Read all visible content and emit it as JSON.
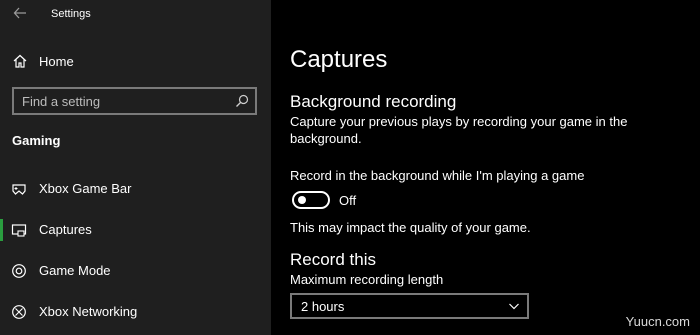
{
  "window": {
    "title": "Settings"
  },
  "sidebar": {
    "home_label": "Home",
    "search_placeholder": "Find a setting",
    "section_heading": "Gaming",
    "items": [
      {
        "label": "Xbox Game Bar",
        "icon": "game-bar-icon"
      },
      {
        "label": "Captures",
        "icon": "captures-icon",
        "selected": true
      },
      {
        "label": "Game Mode",
        "icon": "game-mode-icon"
      },
      {
        "label": "Xbox Networking",
        "icon": "xbox-icon"
      }
    ],
    "accent_color": "#2a9d3f"
  },
  "main": {
    "title": "Captures",
    "background_recording": {
      "heading": "Background recording",
      "description": "Capture your previous plays by recording your game in the background.",
      "toggle_label": "Record in the background while I'm playing a game",
      "toggle_state": "Off",
      "note": "This may impact the quality of your game."
    },
    "record_this": {
      "heading": "Record this",
      "max_length_label": "Maximum recording length",
      "max_length_value": "2 hours"
    }
  },
  "watermark": "Yuucn.com"
}
